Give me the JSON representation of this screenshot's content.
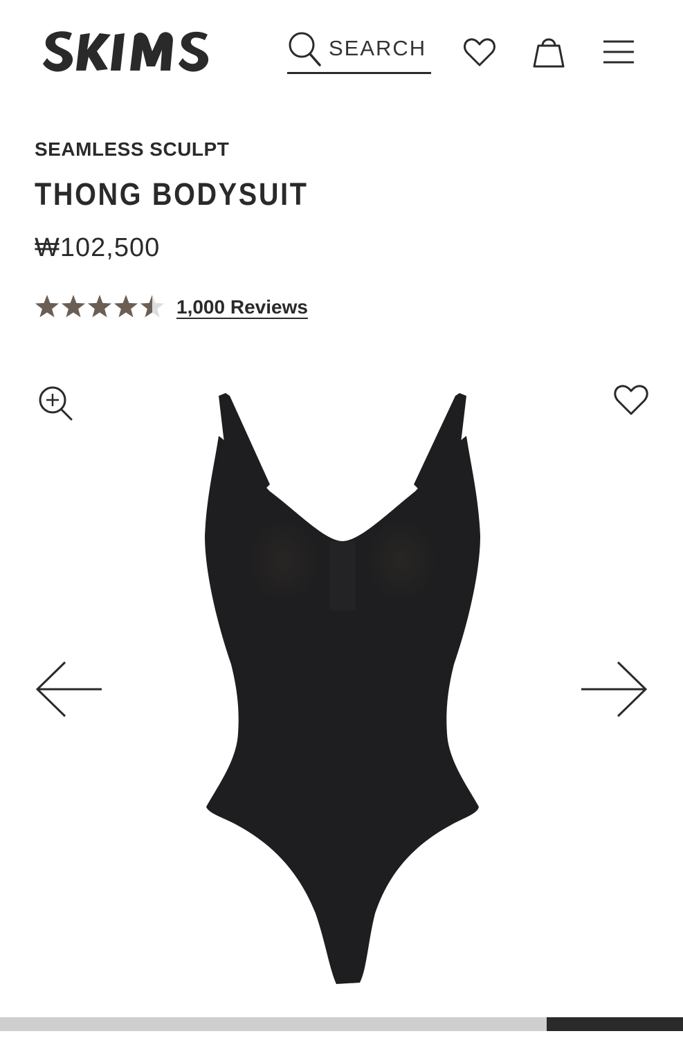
{
  "header": {
    "logo_text": "SKIMS",
    "search_label": "SEARCH",
    "icons": {
      "search": "search-icon",
      "wishlist": "heart-icon",
      "bag": "shopping-bag-icon",
      "menu": "hamburger-menu-icon"
    }
  },
  "product": {
    "collection": "SEAMLESS SCULPT",
    "title": "THONG BODYSUIT",
    "price": "₩102,500",
    "rating": 4.5,
    "rating_max": 5,
    "reviews_label": "1,000 Reviews",
    "image_alt": "black thong bodysuit product image"
  },
  "gallery": {
    "zoom_icon": "zoom-in-icon",
    "favorite_icon": "heart-icon",
    "prev_icon": "arrow-left-icon",
    "next_icon": "arrow-right-icon",
    "progress_fraction": 0.2
  },
  "colors": {
    "text": "#2a2a2a",
    "star_filled": "#6b5e55",
    "star_empty": "#dddddd",
    "progress_track": "#cfcfcf",
    "progress_fill": "#2a2a2a",
    "product": "#1e1e20"
  }
}
